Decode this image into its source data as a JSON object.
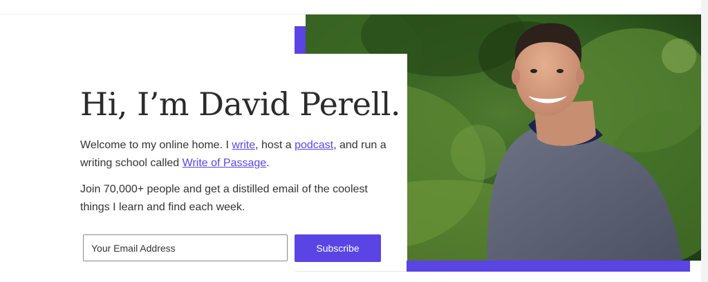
{
  "hero": {
    "headline": "Hi, I’m David Perell.",
    "intro": {
      "part1": "Welcome to my online home. I ",
      "link_write": "write",
      "part2": ", host a ",
      "link_podcast": "podcast",
      "part3": ", and run a writing school called ",
      "link_wop": "Write of Passage",
      "part4": "."
    },
    "pitch": "Join 70,000+ people and get a distilled email of the coolest things I learn and find each week."
  },
  "signup": {
    "email_placeholder": "Your Email Address",
    "email_value": "",
    "subscribe_label": "Subscribe"
  },
  "colors": {
    "accent": "#5a44e4",
    "text": "#333333",
    "headline": "#2b2b2b"
  }
}
